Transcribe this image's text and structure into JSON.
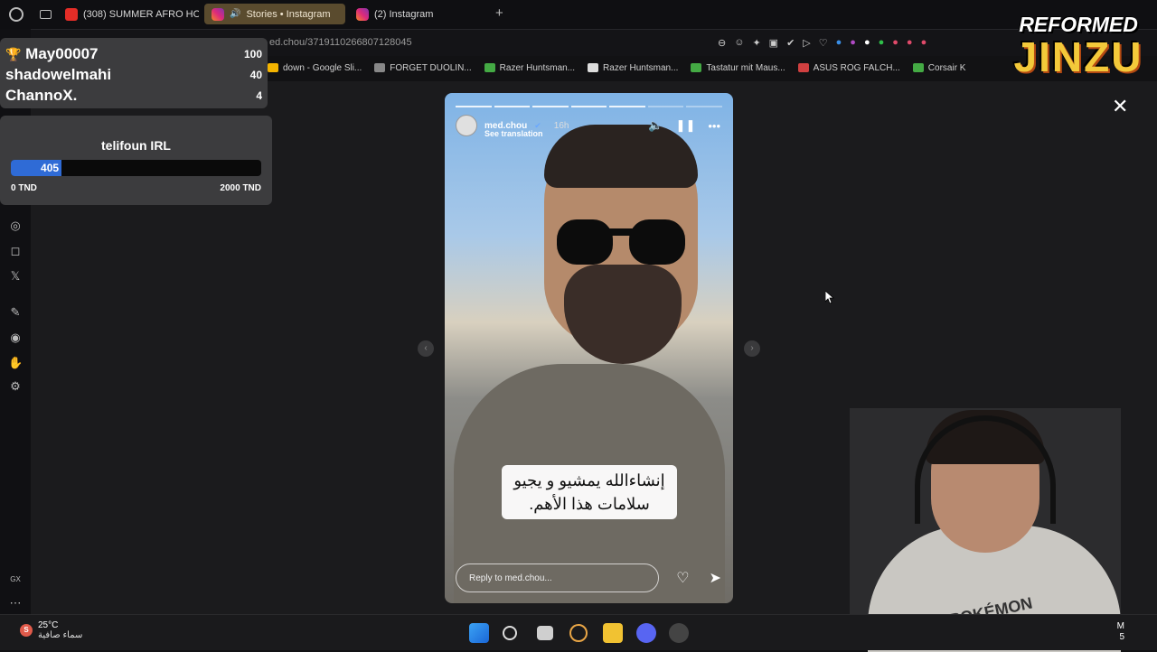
{
  "tabs": [
    {
      "title": "(308) SUMMER AFRO HO",
      "favicon": "youtube-icon",
      "active": false
    },
    {
      "title": "Stories • Instagram",
      "favicon": "instagram-icon",
      "active": true
    },
    {
      "title": "(2) Instagram",
      "favicon": "instagram-icon",
      "active": false
    }
  ],
  "address": {
    "url": "ed.chou/3719110266807128045"
  },
  "bookmarks": [
    {
      "label": "down - Google Sli...",
      "color": "#f4b400"
    },
    {
      "label": "FORGET DUOLIN...",
      "color": "#888888"
    },
    {
      "label": "Razer Huntsman...",
      "color": "#44aa44"
    },
    {
      "label": "Razer Huntsman...",
      "color": "#dddddd"
    },
    {
      "label": "Tastatur mit Maus...",
      "color": "#44aa44"
    },
    {
      "label": "ASUS ROG FALCH...",
      "color": "#d04040"
    },
    {
      "label": "Corsair K",
      "color": "#44aa44"
    }
  ],
  "leaderboard": [
    {
      "name": "May00007",
      "score": "100"
    },
    {
      "name": "shadowelmahi",
      "score": "40"
    },
    {
      "name": "ChannoX.",
      "score": "4"
    }
  ],
  "goal": {
    "title": "telifoun IRL",
    "current": "405",
    "min_label": "0 TND",
    "max_label": "2000 TND",
    "progress": 0.2025
  },
  "logo": {
    "top": "REFORMED",
    "bottom": "JINZU"
  },
  "story": {
    "username": "med.chou",
    "time_ago": "16h",
    "see_translation": "See translation",
    "caption_line1": "إنشاءالله يمشيو و يجيو",
    "caption_line2": "سلامات هذا الأهم.",
    "reply_placeholder": "Reply to med.chou...",
    "segments": 7,
    "current_segment": 5
  },
  "webcam": {
    "shirt_text": "POKÉMON"
  },
  "taskbar": {
    "weather_badge": "S",
    "temperature": "25°C",
    "condition": "سماء صافية",
    "clock_line1": "M",
    "clock_line2": "5"
  },
  "colors": {
    "accent": "#2f6bd6",
    "active_tab": "#5a4b2e",
    "panel": "#3c3c3e"
  }
}
